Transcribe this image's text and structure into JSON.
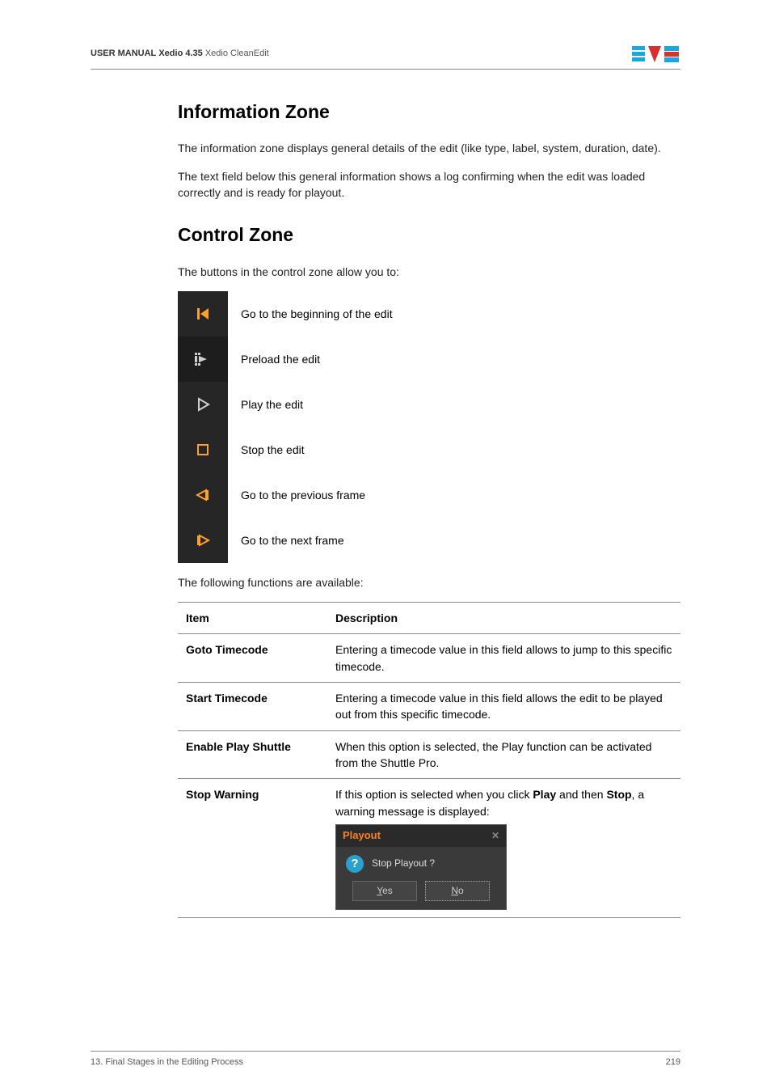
{
  "header": {
    "manual": "USER MANUAL",
    "product": "Xedio 4.35",
    "module": "Xedio CleanEdit"
  },
  "sections": {
    "info": {
      "title": "Information Zone",
      "p1": "The information zone displays general details of the edit (like type, label, system, duration, date).",
      "p2": "The text field below this general information shows a log confirming when the edit was loaded correctly and is ready for playout."
    },
    "control": {
      "title": "Control Zone",
      "intro": "The buttons in the control zone allow you to:",
      "icons": {
        "begin": "Go to the beginning of the edit",
        "preload": "Preload the edit",
        "play": "Play the edit",
        "stop": "Stop the edit",
        "prev": "Go to the previous frame",
        "next": "Go to the next frame"
      },
      "functions_intro": "The following functions are available:",
      "table": {
        "h1": "Item",
        "h2": "Description",
        "r1": {
          "item": "Goto Timecode",
          "desc": "Entering a timecode value in this field allows to jump to this specific timecode."
        },
        "r2": {
          "item": "Start Timecode",
          "desc": "Entering a timecode value in this field allows the edit to be played out from this specific timecode."
        },
        "r3": {
          "item": "Enable Play Shuttle",
          "desc": "When this option is selected, the Play function can be activated from the Shuttle Pro."
        },
        "r4": {
          "item": "Stop Warning",
          "desc_pre": "If this option is selected when you click ",
          "desc_play": "Play",
          "desc_mid": " and then ",
          "desc_stop": "Stop",
          "desc_post": ", a warning message is displayed:",
          "dialog": {
            "title": "Playout",
            "msg": "Stop Playout ?",
            "yes": "Yes",
            "no": "No"
          }
        }
      }
    }
  },
  "footer": {
    "left": "13. Final Stages in the Editing Process",
    "right": "219"
  }
}
